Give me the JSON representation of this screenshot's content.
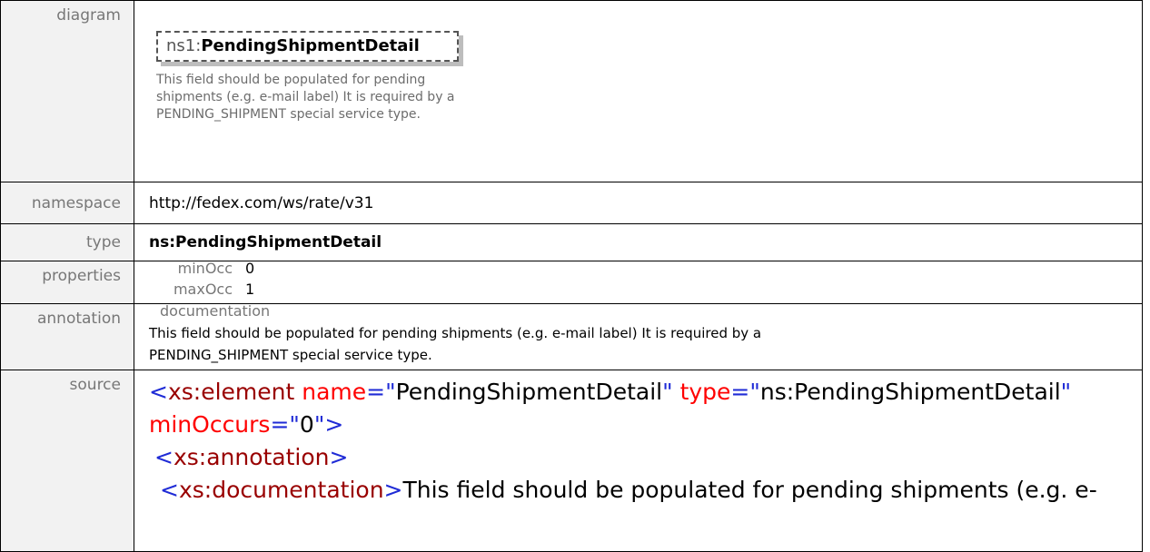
{
  "labels": {
    "diagram": "diagram",
    "namespace": "namespace",
    "type": "type",
    "properties": "properties",
    "annotation": "annotation",
    "source": "source"
  },
  "diagram": {
    "prefix": "ns1:",
    "element_name": "PendingShipmentDetail",
    "doc": "This field should be populated for pending shipments (e.g. e-mail label) It is required by a PENDING_SHIPMENT special service type."
  },
  "namespace": "http://fedex.com/ws/rate/v31",
  "type": "ns:PendingShipmentDetail",
  "properties": {
    "min_key": "minOcc",
    "min_value": "0",
    "max_key": "maxOcc",
    "max_value": "1"
  },
  "annotation": {
    "doc_label": "documentation",
    "doc_line1": "This field should be populated for pending shipments (e.g. e-mail label) It is required by a",
    "doc_line2": "PENDING_SHIPMENT special service type."
  },
  "source": {
    "open_bracket": "<",
    "el_tag": "xs:element",
    "attr_name": "name",
    "eq1": "=\"",
    "name_val": "PendingShipmentDetail",
    "q1": "\"",
    "attr_type": "type",
    "eq2": "=\"",
    "type_val": "ns:PendingShipmentDetail",
    "q2": "\"",
    "attr_min": "minOccurs",
    "eq3": "=\"",
    "min_val": "0",
    "q3": "\"",
    "close_bracket": ">",
    "anno_open_lt": "<",
    "anno_tag": "xs:annotation",
    "anno_open_gt": ">",
    "doc_open_lt": "<",
    "doc_tag": "xs:documentation",
    "doc_open_gt": ">",
    "doc_text": "This field should be populated for pending shipments (e.g. e-"
  }
}
